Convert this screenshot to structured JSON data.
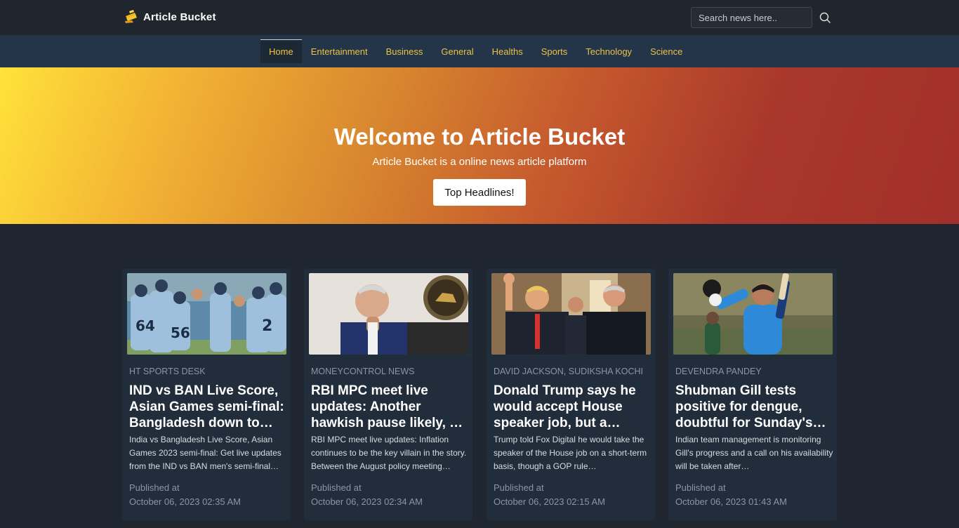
{
  "brand": {
    "name": "Article Bucket",
    "icon": "book-logo-icon"
  },
  "search": {
    "placeholder": "Search news here..",
    "icon": "search-icon"
  },
  "nav": {
    "items": [
      "Home",
      "Entertainment",
      "Business",
      "General",
      "Healths",
      "Sports",
      "Technology",
      "Science"
    ],
    "active": "Home"
  },
  "hero": {
    "title": "Welcome to Article Bucket",
    "subtitle": "Article Bucket is a online news article platform",
    "button": "Top Headlines!"
  },
  "colors": {
    "accent": "#f3c344",
    "background": "#1f2630",
    "nav": "#24354a",
    "card": "#212d3b"
  },
  "cards": [
    {
      "author": "HT SPORTS DESK",
      "title": "IND vs BAN Live Score, Asian Games semi-final: Bangladesh down to last…",
      "description": "India vs Bangladesh Live Score, Asian Games 2023 semi-final: Get live updates from the IND vs BAN men's semi-final match…",
      "published_label": "Published at",
      "date": "October 06, 2023 02:35 AM",
      "image": "cricket-team-huddle-image"
    },
    {
      "author": "MONEYCONTROL NEWS",
      "title": "RBI MPC meet live updates: Another hawkish pause likely, all eyes on…",
      "description": "RBI MPC meet live updates: Inflation continues to be the key villain in the story. Between the August policy meeting…",
      "published_label": "Published at",
      "date": "October 06, 2023 02:34 AM",
      "image": "rbi-governor-image"
    },
    {
      "author": "DAVID JACKSON, SUDIKSHA KOCHI",
      "title": "Donald Trump says he would accept House speaker job, but a GOP…",
      "description": "Trump told Fox Digital he would take the speaker of the House job on a short-term basis, though a GOP rule…",
      "published_label": "Published at",
      "date": "October 06, 2023 02:15 AM",
      "image": "trump-waving-image"
    },
    {
      "author": "DEVENDRA PANDEY",
      "title": "Shubman Gill tests positive for dengue, doubtful for Sunday's…",
      "description": "Indian team management is monitoring Gill's progress and a call on his availability will be taken after…",
      "published_label": "Published at",
      "date": "October 06, 2023 01:43 AM",
      "image": "cricketer-celebrating-image"
    }
  ]
}
